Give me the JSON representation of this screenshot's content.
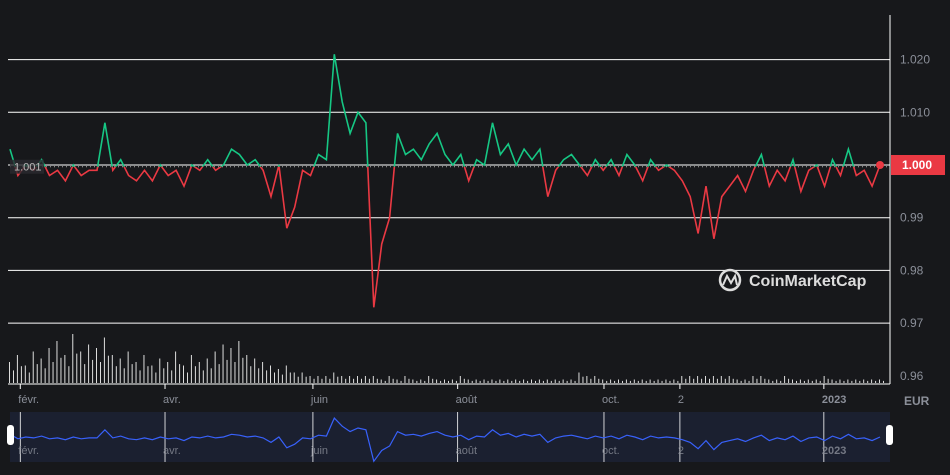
{
  "chart_data": {
    "type": "line",
    "title": "",
    "currency_label": "EUR",
    "watermark": "CoinMarketCap",
    "ylim": [
      0.96,
      1.025
    ],
    "y_ticks": [
      "1.020",
      "1.010",
      "1.000",
      "0.99",
      "0.98",
      "0.97",
      "0.96"
    ],
    "y_tick_values": [
      1.02,
      1.01,
      1.0,
      0.99,
      0.98,
      0.97,
      0.96
    ],
    "x_ticks": [
      {
        "label": "févr.",
        "index": 1.3,
        "bold": false
      },
      {
        "label": "avr.",
        "index": 19.6,
        "bold": false
      },
      {
        "label": "juin",
        "index": 38.3,
        "bold": false
      },
      {
        "label": "août",
        "index": 56.6,
        "bold": false
      },
      {
        "label": "oct.",
        "index": 75.1,
        "bold": false
      },
      {
        "label": "2",
        "index": 84.7,
        "bold": false
      },
      {
        "label": "2023",
        "index": 102.9,
        "bold": true
      }
    ],
    "reference_price": 1.001,
    "reference_label": "1.001",
    "current_price": 1.0,
    "current_label": "1.000",
    "colors": {
      "up": "#16c784",
      "down": "#ea3943",
      "navigator": "#3861fb",
      "grid": "#ffffff"
    },
    "series": [
      {
        "name": "price",
        "values": [
          1.003,
          0.998,
          1.0,
          0.999,
          1.001,
          0.998,
          0.999,
          0.997,
          1.0,
          0.998,
          0.999,
          0.999,
          1.008,
          0.999,
          1.001,
          0.998,
          0.997,
          0.999,
          0.997,
          1.0,
          0.998,
          0.999,
          0.996,
          1.0,
          0.999,
          1.001,
          0.999,
          1.0,
          1.003,
          1.002,
          1.0,
          1.001,
          0.999,
          0.994,
          1.0,
          0.988,
          0.992,
          0.999,
          0.998,
          1.002,
          1.001,
          1.021,
          1.012,
          1.006,
          1.01,
          1.008,
          0.973,
          0.985,
          0.99,
          1.006,
          1.002,
          1.003,
          1.001,
          1.004,
          1.006,
          1.002,
          1.0,
          1.002,
          0.997,
          1.001,
          1.0,
          1.008,
          1.002,
          1.004,
          1.0,
          1.003,
          1.001,
          1.003,
          0.994,
          0.999,
          1.001,
          1.002,
          1.0,
          0.998,
          1.001,
          0.999,
          1.001,
          0.998,
          1.002,
          1.0,
          0.997,
          1.001,
          0.999,
          1.0,
          0.999,
          0.997,
          0.994,
          0.987,
          0.996,
          0.986,
          0.994,
          0.996,
          0.998,
          0.995,
          0.999,
          1.002,
          0.996,
          0.999,
          0.997,
          1.001,
          0.995,
          0.999,
          1.0,
          0.996,
          1.001,
          0.998,
          1.003,
          0.998,
          0.999,
          0.996,
          1.0
        ]
      },
      {
        "name": "volume",
        "values": [
          6,
          8,
          5,
          9,
          7,
          10,
          12,
          8,
          14,
          9,
          11,
          10,
          13,
          8,
          7,
          9,
          6,
          8,
          5,
          7,
          6,
          9,
          5,
          8,
          6,
          7,
          9,
          11,
          10,
          12,
          8,
          7,
          6,
          5,
          4,
          5,
          3,
          3,
          2,
          2,
          2,
          3,
          2,
          2,
          2,
          2,
          2,
          1,
          2,
          1,
          2,
          1,
          1,
          2,
          1,
          1,
          1,
          2,
          1,
          1,
          1,
          1,
          1,
          1,
          1,
          1,
          1,
          1,
          1,
          1,
          1,
          1,
          3,
          2,
          2,
          1,
          1,
          1,
          1,
          1,
          1,
          1,
          1,
          1,
          1,
          2,
          2,
          2,
          2,
          2,
          2,
          2,
          1,
          1,
          2,
          2,
          1,
          1,
          2,
          1,
          1,
          1,
          1,
          2,
          1,
          1,
          1,
          1,
          1,
          1,
          1
        ]
      }
    ]
  }
}
